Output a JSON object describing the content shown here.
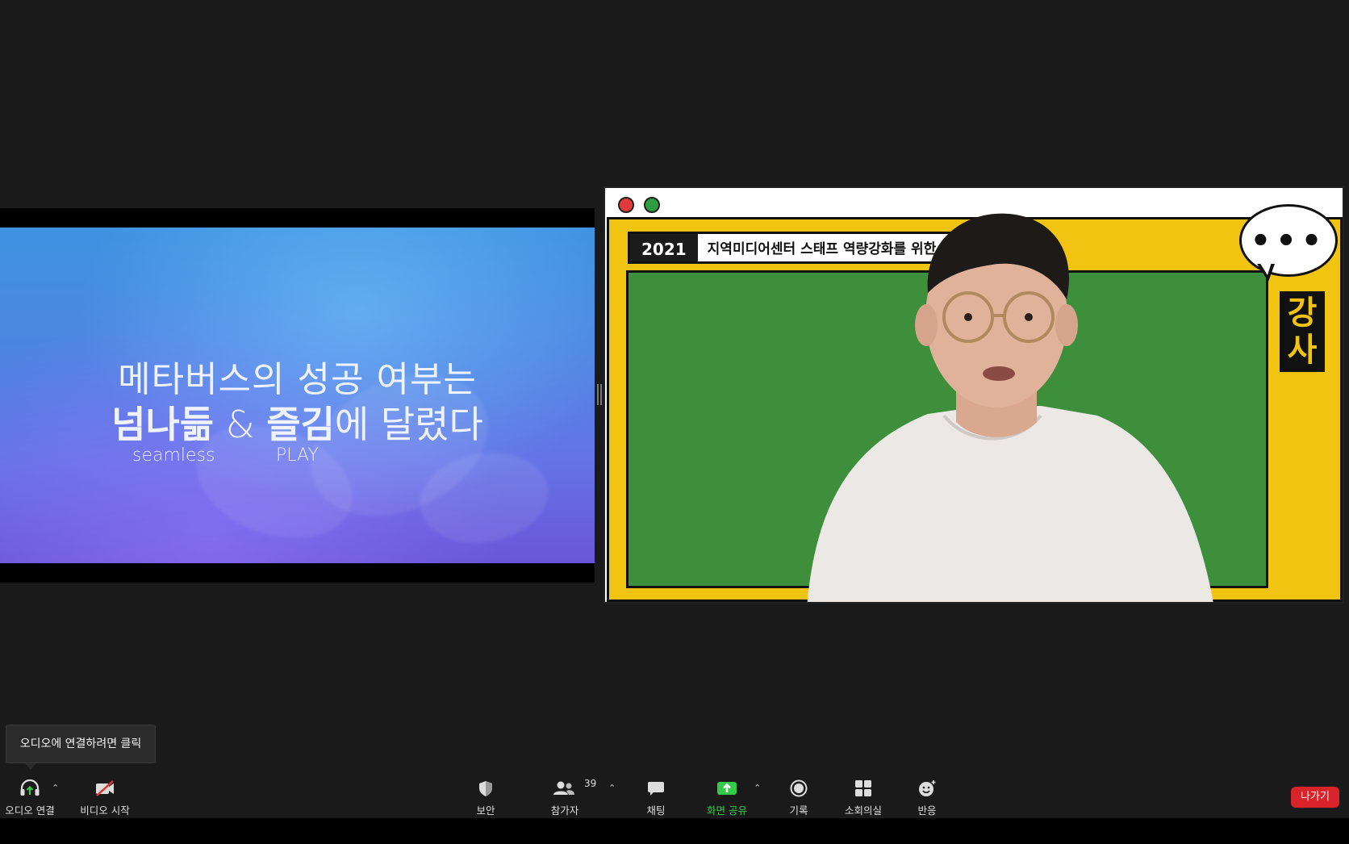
{
  "slide": {
    "line1": "메타버스의 성공 여부는",
    "line2_strong1": "넘나듦",
    "line2_amp": " & ",
    "line2_strong2": "즐김",
    "line2_rest": "에 달렸다",
    "sub1": "seamless",
    "sub2": "PLAY"
  },
  "speaker": {
    "banner_year": "2021",
    "banner_text": "지역미디어센터 스태프 역량강화를 위한 연속",
    "bubble": "•••",
    "side_label_1": "강",
    "side_label_2": "사"
  },
  "tooltip": {
    "text": "오디오에 연결하려면 클릭"
  },
  "toolbar": {
    "audio": {
      "label": "오디오 연결",
      "icon": "headphones-icon"
    },
    "video": {
      "label": "비디오 시작",
      "icon": "video-off-icon"
    },
    "security": {
      "label": "보안",
      "icon": "shield-icon"
    },
    "participants": {
      "label": "참가자",
      "count": "39",
      "icon": "people-icon"
    },
    "chat": {
      "label": "채팅",
      "icon": "chat-icon"
    },
    "share": {
      "label": "화면 공유",
      "icon": "share-screen-icon",
      "color": "#35c94a"
    },
    "record": {
      "label": "기록",
      "icon": "record-icon"
    },
    "breakout": {
      "label": "소회의실",
      "icon": "breakout-icon"
    },
    "reactions": {
      "label": "반응",
      "icon": "emoji-icon"
    },
    "leave": {
      "label": "나가기",
      "color": "#d8232a"
    }
  }
}
